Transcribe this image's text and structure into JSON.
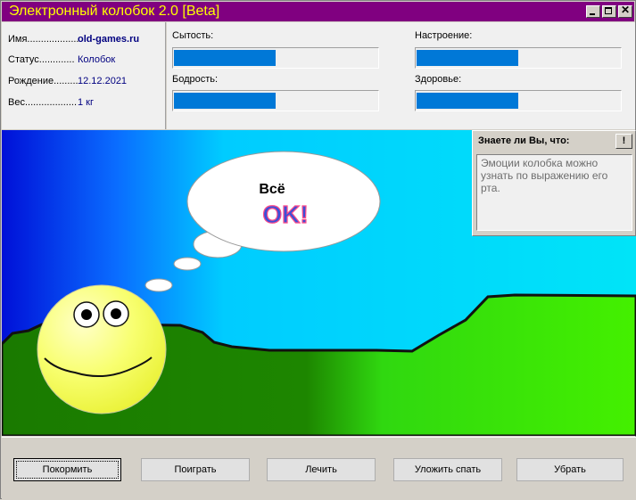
{
  "window": {
    "title": "Электронный колобок 2.0 [Beta]"
  },
  "info": [
    {
      "label": "Имя...................",
      "value": "old-games.ru",
      "bold": true
    },
    {
      "label": "Статус.............",
      "value": "Колобок"
    },
    {
      "label": "Рождение.........",
      "value": "12.12.2021"
    },
    {
      "label": "Вес...................",
      "value": "1 кг"
    }
  ],
  "stats": [
    {
      "label": "Сытость:",
      "level": 0.5
    },
    {
      "label": "Настроение:",
      "level": 0.5
    },
    {
      "label": "Бодрость:",
      "level": 0.5
    },
    {
      "label": "Здоровье:",
      "level": 0.5
    }
  ],
  "bubble": {
    "line1": "Всё",
    "line2": "OK!"
  },
  "tip": {
    "title": "Знаете ли Вы, что:",
    "button": "!",
    "text": "Эмоции колобка можно узнать по выражению его рта."
  },
  "buttons": {
    "feed": "Покормить",
    "play": "Поиграть",
    "heal": "Лечить",
    "sleep": "Уложить спать",
    "clean": "Убрать"
  },
  "colors": {
    "titlebar": "#800080",
    "title_text": "#ffff00",
    "bar_fill": "#0078d7",
    "ground": "#39a800",
    "sky": "#00ccff"
  },
  "icons": [
    "minimize-icon",
    "maximize-icon",
    "close-icon"
  ]
}
